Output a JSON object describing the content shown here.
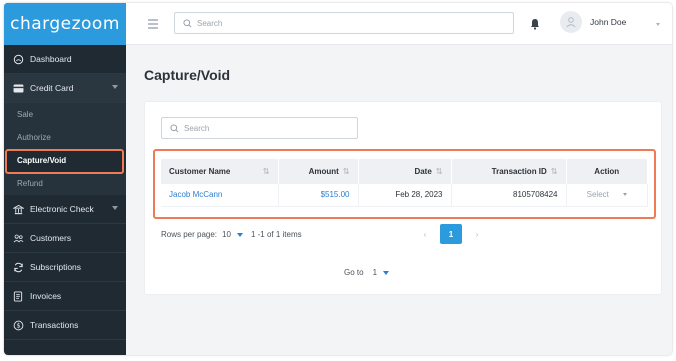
{
  "brand": {
    "logo_text": "chargezoom",
    "logo_color": "#2b9bde"
  },
  "header": {
    "search_placeholder": "Search",
    "user_name": "John Doe"
  },
  "sidebar": {
    "items": [
      {
        "label": "Dashboard",
        "icon": "home-icon"
      },
      {
        "label": "Credit Card",
        "icon": "credit-card-icon",
        "expanded": true,
        "children": [
          "Sale",
          "Authorize",
          "Capture/Void",
          "Refund"
        ]
      },
      {
        "label": "Electronic Check",
        "icon": "bank-icon"
      },
      {
        "label": "Customers",
        "icon": "users-icon"
      },
      {
        "label": "Subscriptions",
        "icon": "refresh-icon"
      },
      {
        "label": "Invoices",
        "icon": "invoice-icon"
      },
      {
        "label": "Transactions",
        "icon": "dollar-circle-icon"
      }
    ],
    "active_child": "Capture/Void"
  },
  "main": {
    "title": "Capture/Void",
    "search_placeholder": "Search",
    "table": {
      "columns": [
        "Customer Name",
        "Amount",
        "Date",
        "Transaction ID",
        "Action"
      ],
      "rows": [
        {
          "customer": "Jacob McCann",
          "amount": "$515.00",
          "date": "Feb 28, 2023",
          "transaction_id": "8105708424",
          "action": "Select"
        }
      ]
    },
    "pagination": {
      "rows_per_page_label": "Rows per page:",
      "rows_per_page": "10",
      "range": "1 -1 of 1 items",
      "current_page": "1",
      "goto_label": "Go to",
      "goto_value": "1"
    }
  },
  "colors": {
    "highlight": "#f07a55",
    "accent": "#2b9bde",
    "sidebar_bg": "#1f2a33"
  }
}
